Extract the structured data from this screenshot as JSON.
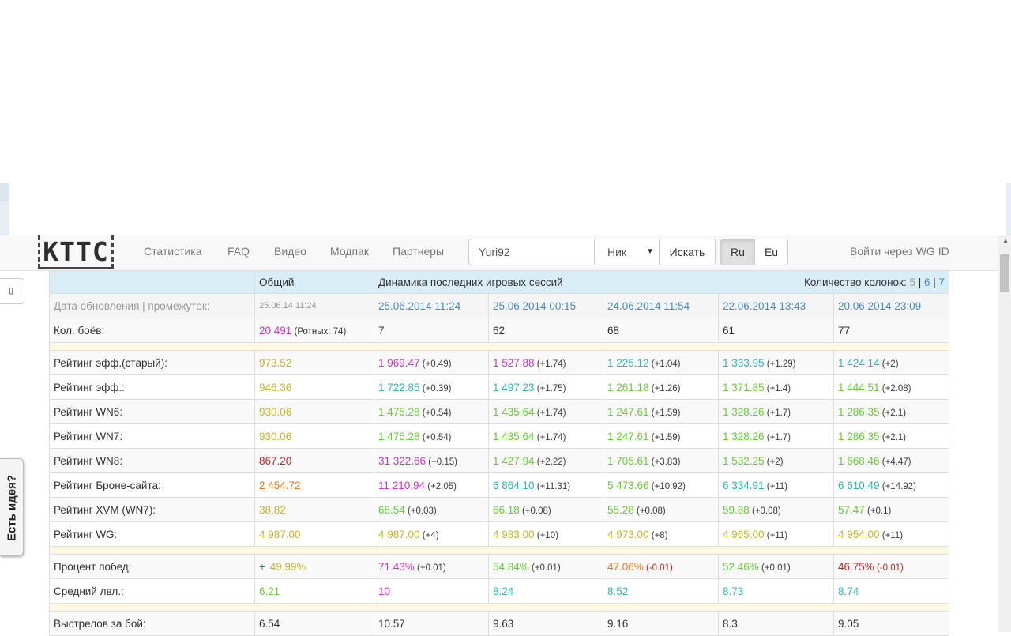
{
  "colors": {
    "purple": "#cc33cc",
    "teal": "#2ab6b6",
    "green": "#66cc33",
    "yellow": "#c8b428",
    "orange": "#e6781e",
    "red": "#cc2222",
    "link": "#428bca"
  },
  "nav": {
    "logo": "KTTC",
    "links": [
      "Статистика",
      "FAQ",
      "Видео",
      "Модпак",
      "Партнеры"
    ],
    "search_value": "Yuri92",
    "search_type": "Ник",
    "search_button": "Искать",
    "region_ru": "Ru",
    "region_eu": "Eu",
    "login": "Войти через WG ID"
  },
  "side": {
    "small_button_icon": "square-icon",
    "idea_tab": "Есть идея?"
  },
  "table": {
    "header_total": "Общий",
    "header_dynamics": "Динамика последних игровых сессий",
    "columns_label": "Количество колонок:",
    "columns_options": [
      "5",
      "6",
      "7"
    ],
    "columns_sep": "|",
    "date_label": "Дата обновления | промежуток:",
    "total_date": "25.06.14 11:24",
    "dates": [
      "25.06.2014 11:24",
      "25.06.2014 00:15",
      "24.06.2014 11:54",
      "22.06.2014 13:43",
      "20.06.2014 23:09"
    ],
    "battles": {
      "label": "Кол. боёв:",
      "total": "20 491",
      "company": "(Ротных: 74)",
      "sessions": [
        "7",
        "62",
        "68",
        "61",
        "77"
      ]
    },
    "group1": [
      {
        "label": "Рейтинг эфф.(старый):",
        "total": "973.52",
        "total_color": "yellow",
        "cells": [
          [
            "1 969.47",
            "(+0.49)",
            "purple"
          ],
          [
            "1 527.88",
            "(+1.74)",
            "purple"
          ],
          [
            "1 225.12",
            "(+1.04)",
            "teal"
          ],
          [
            "1 333.95",
            "(+1.29)",
            "teal"
          ],
          [
            "1 424.14",
            "(+2)",
            "teal"
          ]
        ]
      },
      {
        "label": "Рейтинг эфф.:",
        "total": "946.36",
        "total_color": "yellow",
        "cells": [
          [
            "1 722.85",
            "(+0.39)",
            "teal"
          ],
          [
            "1 497.23",
            "(+1.75)",
            "teal"
          ],
          [
            "1 261.18",
            "(+1.26)",
            "green"
          ],
          [
            "1 371.85",
            "(+1.4)",
            "green"
          ],
          [
            "1 444.51",
            "(+2.08)",
            "green"
          ]
        ]
      },
      {
        "label": "Рейтинг WN6:",
        "total": "930.06",
        "total_color": "yellow",
        "cells": [
          [
            "1 475.28",
            "(+0.54)",
            "green"
          ],
          [
            "1 435.64",
            "(+1.74)",
            "green"
          ],
          [
            "1 247.61",
            "(+1.59)",
            "green"
          ],
          [
            "1 328.26",
            "(+1.7)",
            "green"
          ],
          [
            "1 286.35",
            "(+2.1)",
            "green"
          ]
        ]
      },
      {
        "label": "Рейтинг WN7:",
        "total": "930.06",
        "total_color": "yellow",
        "cells": [
          [
            "1 475.28",
            "(+0.54)",
            "green"
          ],
          [
            "1 435.64",
            "(+1.74)",
            "green"
          ],
          [
            "1 247.61",
            "(+1.59)",
            "green"
          ],
          [
            "1 328.26",
            "(+1.7)",
            "green"
          ],
          [
            "1 286.35",
            "(+2.1)",
            "green"
          ]
        ]
      },
      {
        "label": "Рейтинг WN8:",
        "total": "867.20",
        "total_color": "red",
        "cells": [
          [
            "31 322.66",
            "(+0.15)",
            "purple"
          ],
          [
            "1 427.94",
            "(+2.22)",
            "green"
          ],
          [
            "1 705.61",
            "(+3.83)",
            "green"
          ],
          [
            "1 532.25",
            "(+2)",
            "green"
          ],
          [
            "1 668.46",
            "(+4.47)",
            "green"
          ]
        ]
      },
      {
        "label": "Рейтинг Броне-сайта:",
        "total": "2 454.72",
        "total_color": "orange",
        "cells": [
          [
            "11 210.94",
            "(+2.05)",
            "purple"
          ],
          [
            "6 864.10",
            "(+11.31)",
            "teal"
          ],
          [
            "5 473.66",
            "(+10.92)",
            "green"
          ],
          [
            "6 334.91",
            "(+11)",
            "teal"
          ],
          [
            "6 610.49",
            "(+14.92)",
            "teal"
          ]
        ]
      },
      {
        "label": "Рейтинг XVM (WN7):",
        "total": "38.82",
        "total_color": "yellow",
        "cells": [
          [
            "68.54",
            "(+0.03)",
            "green"
          ],
          [
            "66.18",
            "(+0.08)",
            "green"
          ],
          [
            "55.28",
            "(+0.08)",
            "green"
          ],
          [
            "59.88",
            "(+0.08)",
            "green"
          ],
          [
            "57.47",
            "(+0.1)",
            "green"
          ]
        ]
      },
      {
        "label": "Рейтинг WG:",
        "total": "4 987.00",
        "total_color": "yellow",
        "cells": [
          [
            "4 987.00",
            "(+4)",
            "yellow"
          ],
          [
            "4 983.00",
            "(+10)",
            "yellow"
          ],
          [
            "4 973.00",
            "(+8)",
            "yellow"
          ],
          [
            "4 965.00",
            "(+11)",
            "yellow"
          ],
          [
            "4 954.00",
            "(+11)",
            "yellow"
          ]
        ]
      }
    ],
    "group2": [
      {
        "label": "Процент побед:",
        "total_prefix": "+",
        "total": "49.99%",
        "total_color": "yellow",
        "cells": [
          [
            "71.43%",
            "(+0.01)",
            "purple"
          ],
          [
            "54.84%",
            "(+0.01)",
            "green"
          ],
          [
            "47.06%",
            "(-0.01)",
            "orange"
          ],
          [
            "52.46%",
            "(+0.01)",
            "green"
          ],
          [
            "46.75%",
            "(-0.01)",
            "red"
          ]
        ]
      },
      {
        "label": "Средний лвл.:",
        "total": "6.21",
        "total_color": "green",
        "cells": [
          [
            "10",
            "",
            "purple"
          ],
          [
            "8.24",
            "",
            "teal"
          ],
          [
            "8.52",
            "",
            "teal"
          ],
          [
            "8.73",
            "",
            "teal"
          ],
          [
            "8.74",
            "",
            "teal"
          ]
        ]
      }
    ],
    "group3": [
      {
        "label": "Выстрелов за бой:",
        "total": "6.54",
        "cells": [
          "10.57",
          "9.63",
          "9.16",
          "8.3",
          "9.05"
        ]
      }
    ]
  }
}
